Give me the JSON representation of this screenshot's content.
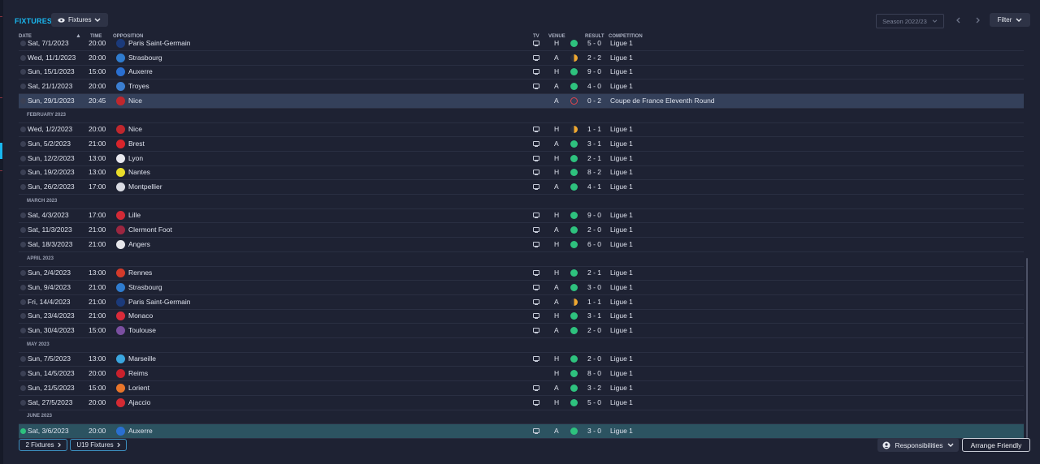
{
  "header": {
    "title": "FIXTURES",
    "view_label": "Fixtures",
    "season_label": "Season 2022/23",
    "filter_label": "Filter"
  },
  "columns": {
    "date": "DATE",
    "time": "TIME",
    "opposition": "OPPOSITION",
    "tv": "TV",
    "venue": "VENUE",
    "result": "RESULT",
    "competition": "COMPETITION"
  },
  "months": [
    "FEBRUARY 2023",
    "MARCH 2023",
    "APRIL 2023",
    "MAY 2023",
    "JUNE 2023"
  ],
  "fixtures": [
    {
      "date": "Sat, 7/1/2023",
      "time": "20:00",
      "opp": "Paris Saint-Germain",
      "tv": true,
      "venue": "H",
      "result": "win",
      "score": "5 - 0",
      "comp": "Ligue 1",
      "color": "#1b3a7a"
    },
    {
      "date": "Wed, 11/1/2023",
      "time": "20:00",
      "opp": "Strasbourg",
      "tv": true,
      "venue": "A",
      "result": "draw",
      "score": "2 - 2",
      "comp": "Ligue 1",
      "color": "#2f7ccf"
    },
    {
      "date": "Sun, 15/1/2023",
      "time": "15:00",
      "opp": "Auxerre",
      "tv": true,
      "venue": "H",
      "result": "win",
      "score": "9 - 0",
      "comp": "Ligue 1",
      "color": "#2a6fd1"
    },
    {
      "date": "Sat, 21/1/2023",
      "time": "20:00",
      "opp": "Troyes",
      "tv": true,
      "venue": "A",
      "result": "win",
      "score": "4 - 0",
      "comp": "Ligue 1",
      "color": "#3b7ed0"
    },
    {
      "date": "Sun, 29/1/2023",
      "time": "20:45",
      "opp": "Nice",
      "tv": false,
      "venue": "A",
      "result": "loss",
      "score": "0 - 2",
      "comp": "Coupe de France Eleventh Round",
      "color": "#c0272d"
    },
    {
      "date": "Wed, 1/2/2023",
      "time": "20:00",
      "opp": "Nice",
      "tv": true,
      "venue": "H",
      "result": "draw",
      "score": "1 - 1",
      "comp": "Ligue 1",
      "color": "#c0272d"
    },
    {
      "date": "Sun, 5/2/2023",
      "time": "21:00",
      "opp": "Brest",
      "tv": true,
      "venue": "A",
      "result": "win",
      "score": "3 - 1",
      "comp": "Ligue 1",
      "color": "#d8242b"
    },
    {
      "date": "Sun, 12/2/2023",
      "time": "13:00",
      "opp": "Lyon",
      "tv": true,
      "venue": "H",
      "result": "win",
      "score": "2 - 1",
      "comp": "Ligue 1",
      "color": "#e8e8ee"
    },
    {
      "date": "Sun, 19/2/2023",
      "time": "13:00",
      "opp": "Nantes",
      "tv": true,
      "venue": "H",
      "result": "win",
      "score": "8 - 2",
      "comp": "Ligue 1",
      "color": "#e8dc2a"
    },
    {
      "date": "Sun, 26/2/2023",
      "time": "17:00",
      "opp": "Montpellier",
      "tv": true,
      "venue": "A",
      "result": "win",
      "score": "4 - 1",
      "comp": "Ligue 1",
      "color": "#d9dbe3"
    },
    {
      "date": "Sat, 4/3/2023",
      "time": "17:00",
      "opp": "Lille",
      "tv": true,
      "venue": "H",
      "result": "win",
      "score": "9 - 0",
      "comp": "Ligue 1",
      "color": "#d22a36"
    },
    {
      "date": "Sat, 11/3/2023",
      "time": "21:00",
      "opp": "Clermont Foot",
      "tv": true,
      "venue": "A",
      "result": "win",
      "score": "2 - 0",
      "comp": "Ligue 1",
      "color": "#9c2640"
    },
    {
      "date": "Sat, 18/3/2023",
      "time": "21:00",
      "opp": "Angers",
      "tv": true,
      "venue": "H",
      "result": "win",
      "score": "6 - 0",
      "comp": "Ligue 1",
      "color": "#e6e6ea"
    },
    {
      "date": "Sun, 2/4/2023",
      "time": "13:00",
      "opp": "Rennes",
      "tv": true,
      "venue": "H",
      "result": "win",
      "score": "2 - 1",
      "comp": "Ligue 1",
      "color": "#d33a2a"
    },
    {
      "date": "Sun, 9/4/2023",
      "time": "21:00",
      "opp": "Strasbourg",
      "tv": true,
      "venue": "A",
      "result": "win",
      "score": "3 - 0",
      "comp": "Ligue 1",
      "color": "#2f7ccf"
    },
    {
      "date": "Fri, 14/4/2023",
      "time": "21:00",
      "opp": "Paris Saint-Germain",
      "tv": true,
      "venue": "A",
      "result": "draw",
      "score": "1 - 1",
      "comp": "Ligue 1",
      "color": "#1b3a7a"
    },
    {
      "date": "Sun, 23/4/2023",
      "time": "21:00",
      "opp": "Monaco",
      "tv": true,
      "venue": "H",
      "result": "win",
      "score": "3 - 1",
      "comp": "Ligue 1",
      "color": "#d92b3a"
    },
    {
      "date": "Sun, 30/4/2023",
      "time": "15:00",
      "opp": "Toulouse",
      "tv": true,
      "venue": "A",
      "result": "win",
      "score": "2 - 0",
      "comp": "Ligue 1",
      "color": "#7a4fa0"
    },
    {
      "date": "Sun, 7/5/2023",
      "time": "13:00",
      "opp": "Marseille",
      "tv": true,
      "venue": "H",
      "result": "win",
      "score": "2 - 0",
      "comp": "Ligue 1",
      "color": "#3aa6df"
    },
    {
      "date": "Sun, 14/5/2023",
      "time": "20:00",
      "opp": "Reims",
      "tv": false,
      "venue": "H",
      "result": "win",
      "score": "8 - 0",
      "comp": "Ligue 1",
      "color": "#c8202c"
    },
    {
      "date": "Sun, 21/5/2023",
      "time": "15:00",
      "opp": "Lorient",
      "tv": true,
      "venue": "A",
      "result": "win",
      "score": "3 - 2",
      "comp": "Ligue 1",
      "color": "#e8752a"
    },
    {
      "date": "Sat, 27/5/2023",
      "time": "20:00",
      "opp": "Ajaccio",
      "tv": true,
      "venue": "H",
      "result": "win",
      "score": "5 - 0",
      "comp": "Ligue 1",
      "color": "#d32a33"
    },
    {
      "date": "Sat, 3/6/2023",
      "time": "20:00",
      "opp": "Auxerre",
      "tv": true,
      "venue": "A",
      "result": "win",
      "score": "3 - 0",
      "comp": "Ligue 1",
      "color": "#2a6fd1"
    }
  ],
  "footer": {
    "fixtures_2": "2 Fixtures",
    "u19_fixtures": "U19 Fixtures",
    "responsibilities": "Responsibilities",
    "arrange_friendly": "Arrange Friendly"
  }
}
